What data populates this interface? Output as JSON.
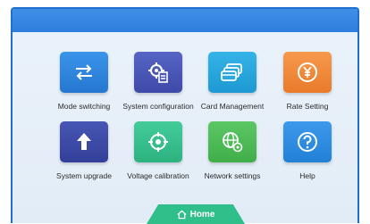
{
  "footer": {
    "home_label": "Home"
  },
  "menu": [
    {
      "label": "Mode switching",
      "icon": "arrows-swap-icon",
      "color": "#2f86df"
    },
    {
      "label": "System configuration",
      "icon": "gear-document-icon",
      "color": "#4b58b8"
    },
    {
      "label": "Card Management",
      "icon": "cards-icon",
      "color": "#2aa8e0"
    },
    {
      "label": "Rate Setting",
      "icon": "currency-coin-icon",
      "color": "#f08a3c"
    },
    {
      "label": "System upgrade",
      "icon": "arrow-up-icon",
      "color": "#3c4ca8"
    },
    {
      "label": "Voltage calibration",
      "icon": "target-icon",
      "color": "#35c08e"
    },
    {
      "label": "Network settings",
      "icon": "network-globe-icon",
      "color": "#4cbb55"
    },
    {
      "label": "Help",
      "icon": "question-icon",
      "color": "#2f8fe6"
    }
  ]
}
